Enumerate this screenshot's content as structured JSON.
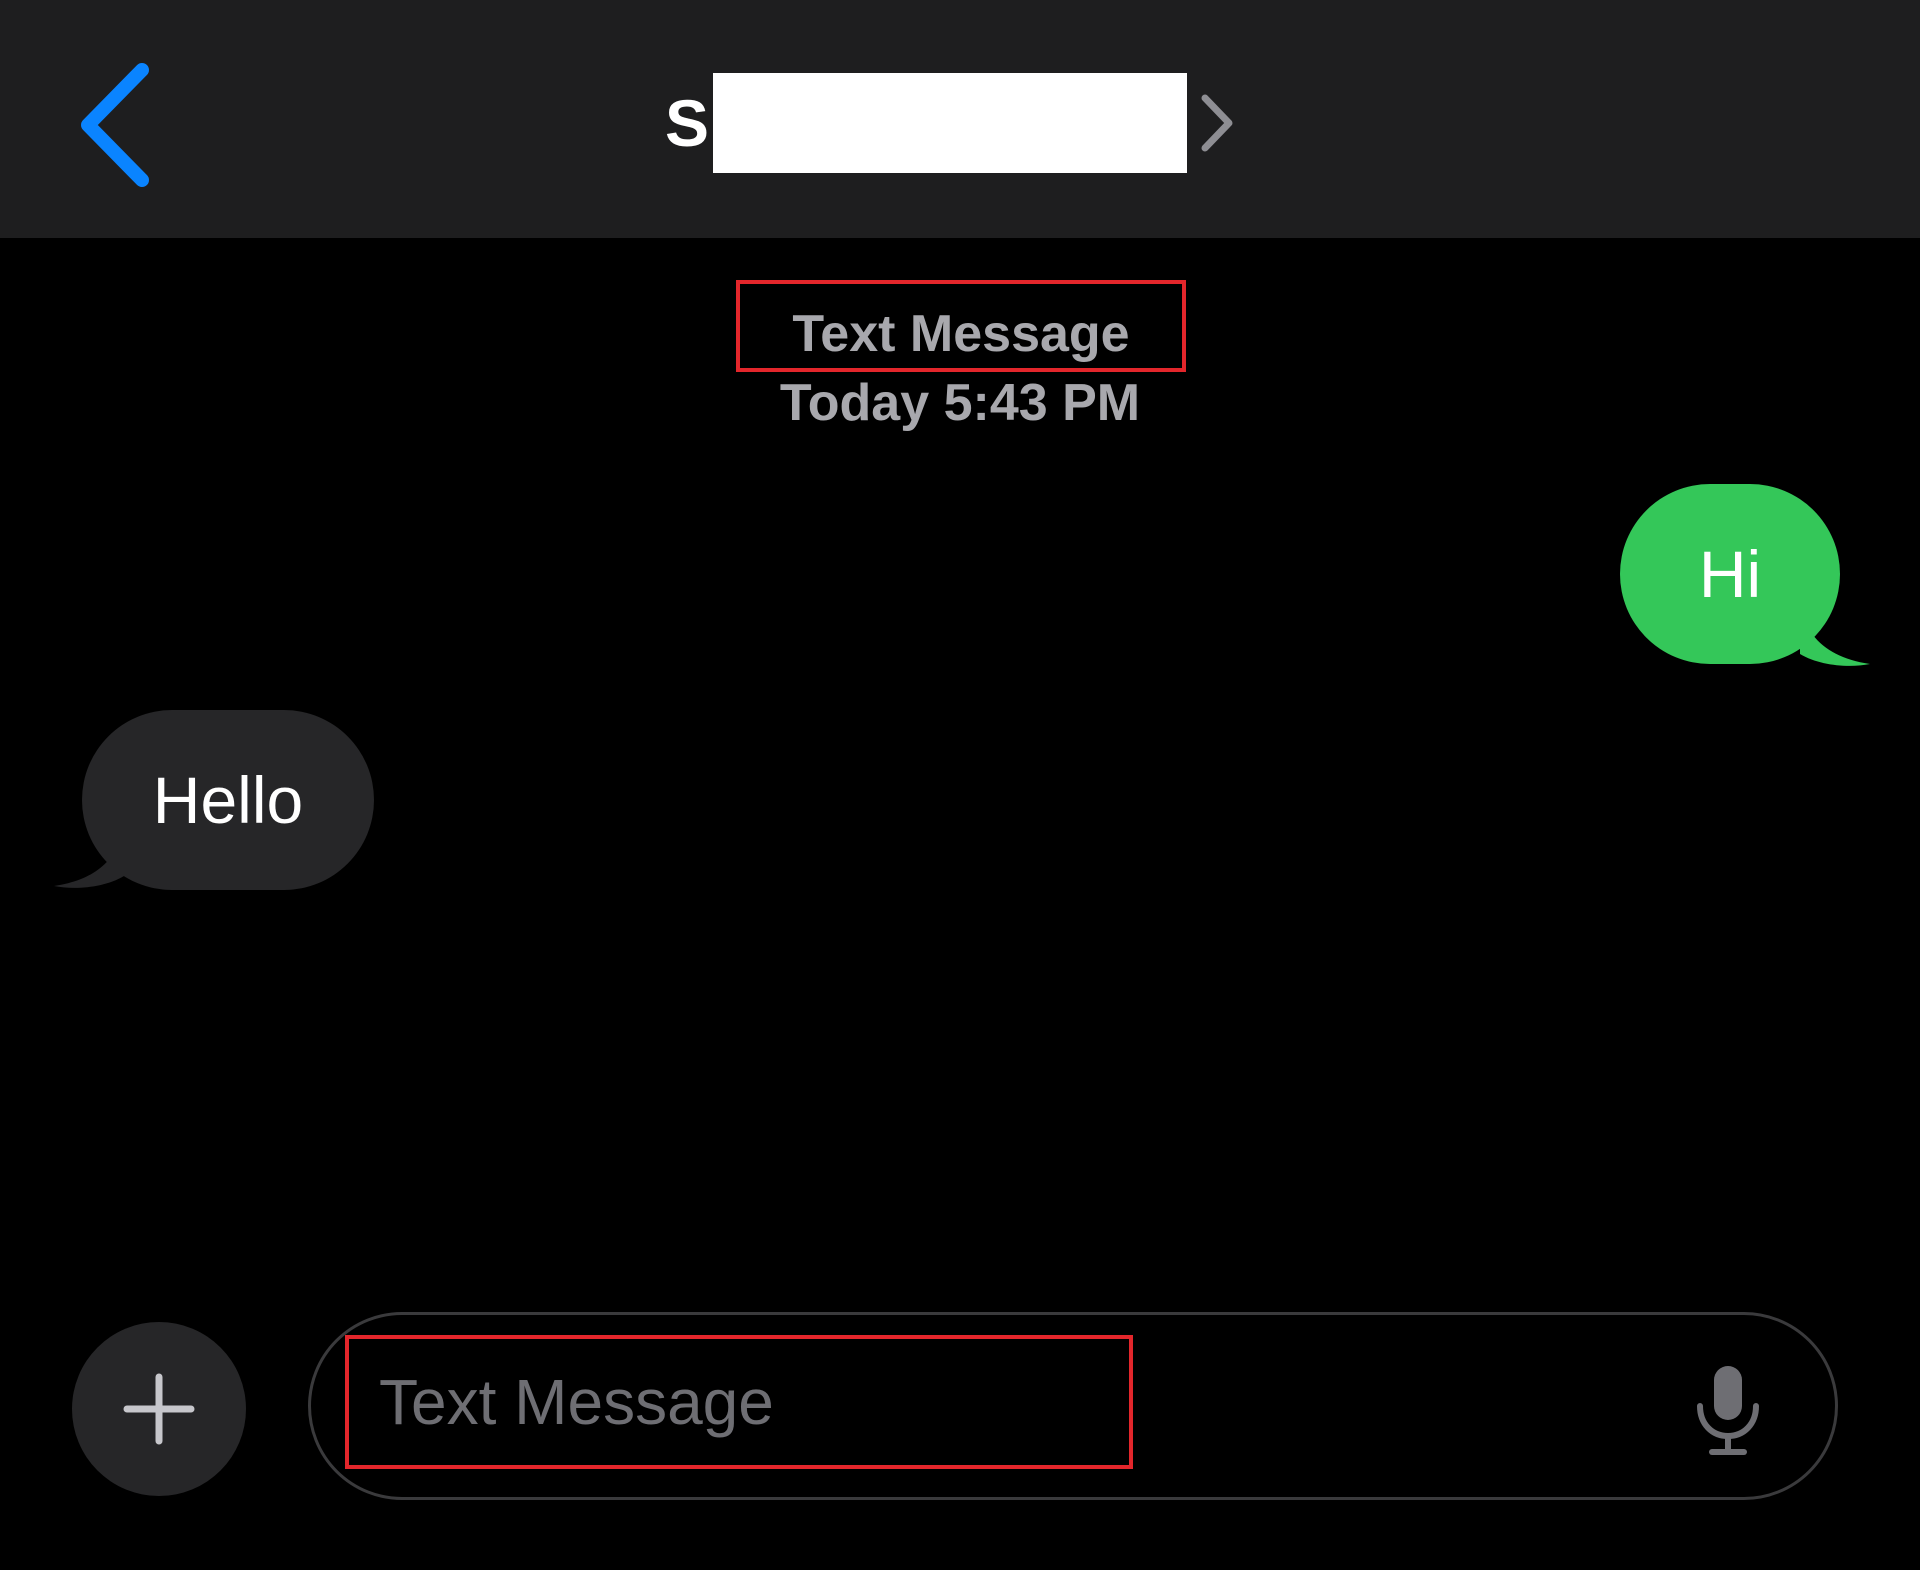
{
  "header": {
    "contact_initial": "S",
    "back_icon": "chevron-left-icon",
    "contact_chevron_icon": "chevron-right-icon"
  },
  "conversation": {
    "service_label": "Text Message",
    "timestamp": "Today 5:43 PM",
    "messages": [
      {
        "direction": "outgoing",
        "text": "Hi"
      },
      {
        "direction": "incoming",
        "text": "Hello"
      }
    ]
  },
  "composer": {
    "placeholder": "Text Message",
    "value": "",
    "plus_icon": "plus-icon",
    "mic_icon": "microphone-icon"
  },
  "colors": {
    "background": "#000000",
    "header_background": "#1e1e1f",
    "accent_blue": "#0a84ff",
    "outgoing_bubble": "#34c759",
    "incoming_bubble": "#262628",
    "annotation_red": "#e3262b",
    "secondary_text": "#a8a8ad"
  }
}
